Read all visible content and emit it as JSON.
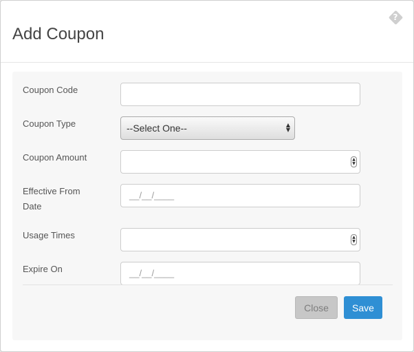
{
  "modal": {
    "title": "Add Coupon",
    "close_icon": "close-icon"
  },
  "form": {
    "coupon_code": {
      "label": "Coupon Code",
      "value": ""
    },
    "coupon_type": {
      "label": "Coupon Type",
      "selected": "--Select One--"
    },
    "coupon_amount": {
      "label": "Coupon Amount",
      "value": ""
    },
    "effective_from": {
      "label_line1": "Effective From",
      "label_line2": "Date",
      "placeholder": "__/__/____"
    },
    "usage_times": {
      "label": "Usage Times",
      "value": ""
    },
    "expire_on": {
      "label": "Expire On",
      "placeholder": "__/__/____"
    }
  },
  "footer": {
    "close_label": "Close",
    "save_label": "Save"
  },
  "colors": {
    "save_button": "#2f8fd4",
    "close_button": "#c7c7c7"
  }
}
